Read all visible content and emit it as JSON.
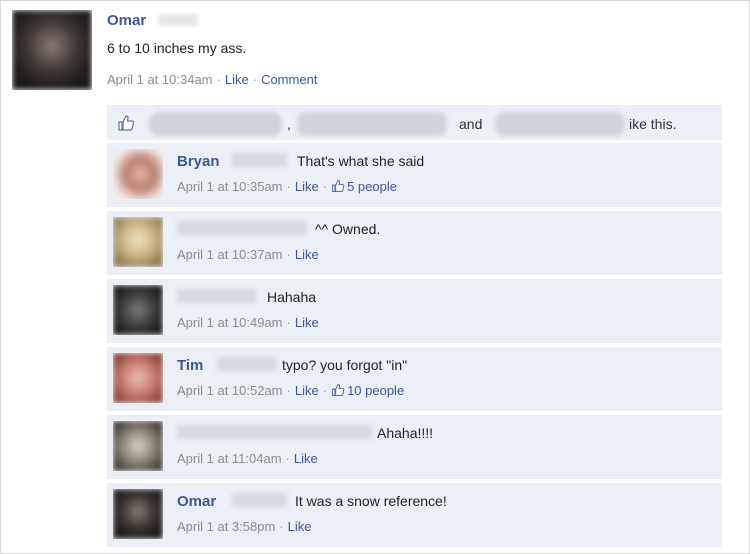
{
  "post": {
    "author": "Omar",
    "text": "6 to 10 inches my ass.",
    "timestamp": "April 1 at 10:34am",
    "like_label": "Like",
    "comment_label": "Comment"
  },
  "likes": {
    "comma": ",",
    "and_label": "and",
    "suffix": "ike this.",
    "icon": "thumbs-up-icon"
  },
  "comments": [
    {
      "author": "Bryan",
      "text": "That's what she said",
      "timestamp": "April 1 at 10:35am",
      "like_label": "Like",
      "likes_count": "5 people"
    },
    {
      "author": "",
      "text": "^^ Owned.",
      "timestamp": "April 1 at 10:37am",
      "like_label": "Like"
    },
    {
      "author": "",
      "text": "Hahaha",
      "timestamp": "April 1 at 10:49am",
      "like_label": "Like"
    },
    {
      "author": "Tim",
      "text": "typo? you forgot \"in\"",
      "timestamp": "April 1 at 10:52am",
      "like_label": "Like",
      "likes_count": "10 people"
    },
    {
      "author": "",
      "text": "Ahaha!!!!",
      "timestamp": "April 1 at 11:04am",
      "like_label": "Like"
    },
    {
      "author": "Omar",
      "text": "It was a snow reference!",
      "timestamp": "April 1 at 3:58pm",
      "like_label": "Like"
    }
  ],
  "colors": {
    "link": "#3b5998",
    "comment_bg": "#eceff5",
    "meta": "#8c8c8c"
  }
}
